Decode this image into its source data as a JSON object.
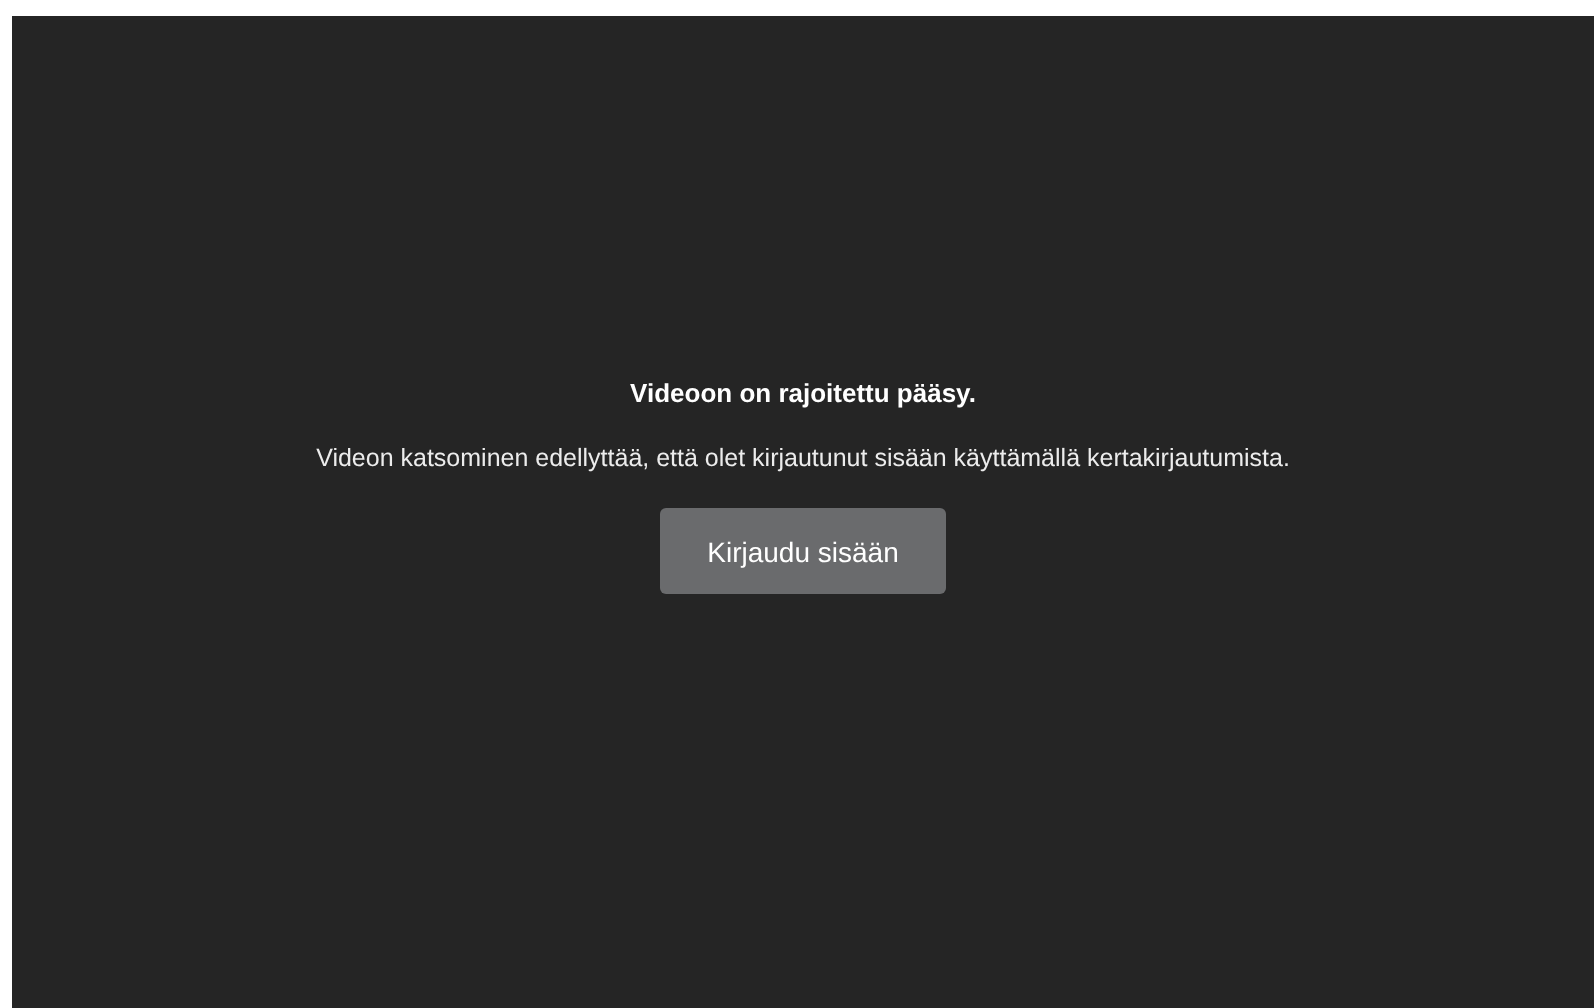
{
  "player": {
    "title": "Videoon on rajoitettu pääsy.",
    "message": "Videon katsominen edellyttää, että olet kirjautunut sisään käyttämällä kertakirjautumista.",
    "button": "Kirjaudu sisään"
  }
}
